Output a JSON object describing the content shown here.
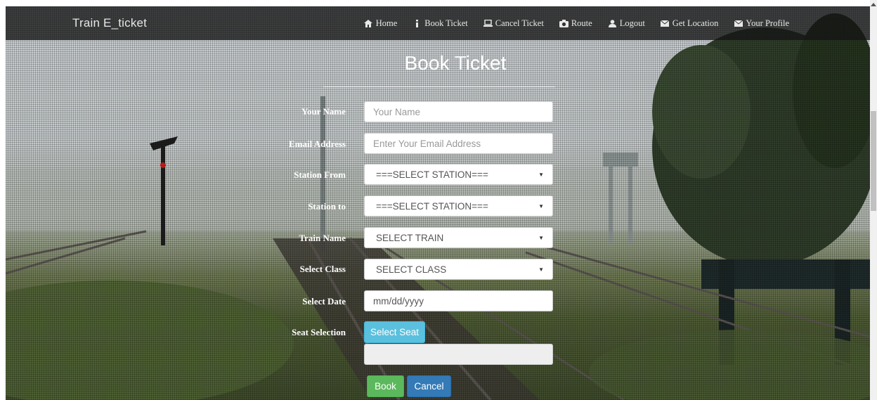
{
  "navbar": {
    "brand": "Train E_ticket",
    "items": [
      {
        "label": "Home",
        "icon": "home-icon"
      },
      {
        "label": "Book Ticket",
        "icon": "info-icon"
      },
      {
        "label": "Cancel Ticket",
        "icon": "laptop-icon"
      },
      {
        "label": "Route",
        "icon": "camera-icon"
      },
      {
        "label": "Logout",
        "icon": "user-icon"
      },
      {
        "label": "Get Location",
        "icon": "envelope-icon"
      },
      {
        "label": "Your Profile",
        "icon": "envelope-icon"
      }
    ]
  },
  "form": {
    "title": "Book Ticket",
    "name": {
      "label": "Your Name",
      "placeholder": "Your Name"
    },
    "email": {
      "label": "Email Address",
      "placeholder": "Enter Your Email Address"
    },
    "station_from": {
      "label": "Station From",
      "value": "===SELECT STATION==="
    },
    "station_to": {
      "label": "Station to",
      "value": "===SELECT STATION==="
    },
    "train": {
      "label": "Train Name",
      "value": "SELECT TRAIN"
    },
    "class": {
      "label": "Select Class",
      "value": "SELECT CLASS"
    },
    "date": {
      "label": "Select Date",
      "placeholder": "mm/dd/yyyy"
    },
    "seat": {
      "label": "Seat Selection",
      "button": "Select Seat",
      "value": ""
    },
    "book_label": "Book",
    "cancel_label": "Cancel"
  },
  "colors": {
    "navbar_bg": "#141414",
    "info": "#5bc0de",
    "success": "#5cb85c",
    "primary": "#337ab7"
  }
}
